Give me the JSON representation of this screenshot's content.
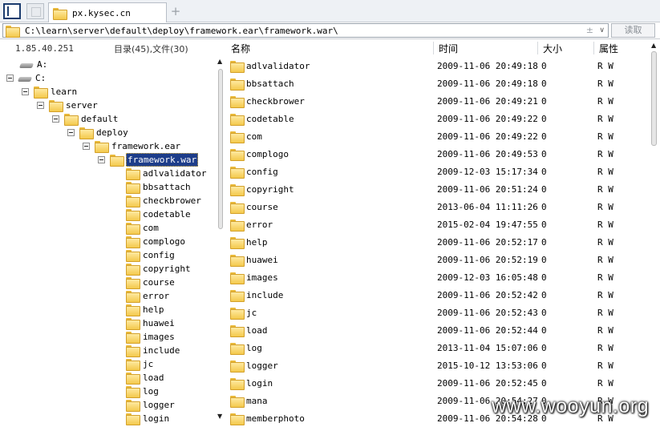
{
  "tabbar": {
    "tab_label": "px.kysec.cn",
    "add_symbol": "+"
  },
  "pathbar": {
    "path": "C:\\learn\\server\\default\\deploy\\framework.ear\\framework.war\\",
    "plus_minus": "±",
    "dropdown": "∨",
    "read_button": "读取"
  },
  "left": {
    "ip": "1.85.40.251",
    "count": "目录(45),文件(30)",
    "tree": [
      {
        "label": "A:",
        "type": "drive"
      },
      {
        "label": "C:",
        "type": "drive"
      },
      {
        "label": "learn",
        "type": "folder"
      },
      {
        "label": "server",
        "type": "folder"
      },
      {
        "label": "default",
        "type": "folder"
      },
      {
        "label": "deploy",
        "type": "folder"
      },
      {
        "label": "framework.ear",
        "type": "folder"
      },
      {
        "label": "framework.war",
        "type": "folder",
        "selected": true
      },
      {
        "label": "adlvalidator",
        "type": "folder"
      },
      {
        "label": "bbsattach",
        "type": "folder"
      },
      {
        "label": "checkbrower",
        "type": "folder"
      },
      {
        "label": "codetable",
        "type": "folder"
      },
      {
        "label": "com",
        "type": "folder"
      },
      {
        "label": "complogo",
        "type": "folder"
      },
      {
        "label": "config",
        "type": "folder"
      },
      {
        "label": "copyright",
        "type": "folder"
      },
      {
        "label": "course",
        "type": "folder"
      },
      {
        "label": "error",
        "type": "folder"
      },
      {
        "label": "help",
        "type": "folder"
      },
      {
        "label": "huawei",
        "type": "folder"
      },
      {
        "label": "images",
        "type": "folder"
      },
      {
        "label": "include",
        "type": "folder"
      },
      {
        "label": "jc",
        "type": "folder"
      },
      {
        "label": "load",
        "type": "folder"
      },
      {
        "label": "log",
        "type": "folder"
      },
      {
        "label": "logger",
        "type": "folder"
      },
      {
        "label": "login",
        "type": "folder"
      }
    ]
  },
  "right": {
    "columns": {
      "name": "名称",
      "time": "时间",
      "size": "大小",
      "attr": "属性"
    },
    "rows": [
      {
        "name": "adlvalidator",
        "time": "2009-11-06 20:49:18",
        "size": "0",
        "attr": "R W"
      },
      {
        "name": "bbsattach",
        "time": "2009-11-06 20:49:18",
        "size": "0",
        "attr": "R W"
      },
      {
        "name": "checkbrower",
        "time": "2009-11-06 20:49:21",
        "size": "0",
        "attr": "R W"
      },
      {
        "name": "codetable",
        "time": "2009-11-06 20:49:22",
        "size": "0",
        "attr": "R W"
      },
      {
        "name": "com",
        "time": "2009-11-06 20:49:22",
        "size": "0",
        "attr": "R W"
      },
      {
        "name": "complogo",
        "time": "2009-11-06 20:49:53",
        "size": "0",
        "attr": "R W"
      },
      {
        "name": "config",
        "time": "2009-12-03 15:17:34",
        "size": "0",
        "attr": "R W"
      },
      {
        "name": "copyright",
        "time": "2009-11-06 20:51:24",
        "size": "0",
        "attr": "R W"
      },
      {
        "name": "course",
        "time": "2013-06-04 11:11:26",
        "size": "0",
        "attr": "R W"
      },
      {
        "name": "error",
        "time": "2015-02-04 19:47:55",
        "size": "0",
        "attr": "R W"
      },
      {
        "name": "help",
        "time": "2009-11-06 20:52:17",
        "size": "0",
        "attr": "R W"
      },
      {
        "name": "huawei",
        "time": "2009-11-06 20:52:19",
        "size": "0",
        "attr": "R W"
      },
      {
        "name": "images",
        "time": "2009-12-03 16:05:48",
        "size": "0",
        "attr": "R W"
      },
      {
        "name": "include",
        "time": "2009-11-06 20:52:42",
        "size": "0",
        "attr": "R W"
      },
      {
        "name": "jc",
        "time": "2009-11-06 20:52:43",
        "size": "0",
        "attr": "R W"
      },
      {
        "name": "load",
        "time": "2009-11-06 20:52:44",
        "size": "0",
        "attr": "R W"
      },
      {
        "name": "log",
        "time": "2013-11-04 15:07:06",
        "size": "0",
        "attr": "R W"
      },
      {
        "name": "logger",
        "time": "2015-10-12 13:53:06",
        "size": "0",
        "attr": "R W"
      },
      {
        "name": "login",
        "time": "2009-11-06 20:52:45",
        "size": "0",
        "attr": "R W"
      },
      {
        "name": "mana",
        "time": "2009-11-06 20:54:27",
        "size": "0",
        "attr": "R W"
      },
      {
        "name": "memberphoto",
        "time": "2009-11-06 20:54:28",
        "size": "0",
        "attr": "R W"
      }
    ]
  },
  "watermark": "www.wooyun.org"
}
